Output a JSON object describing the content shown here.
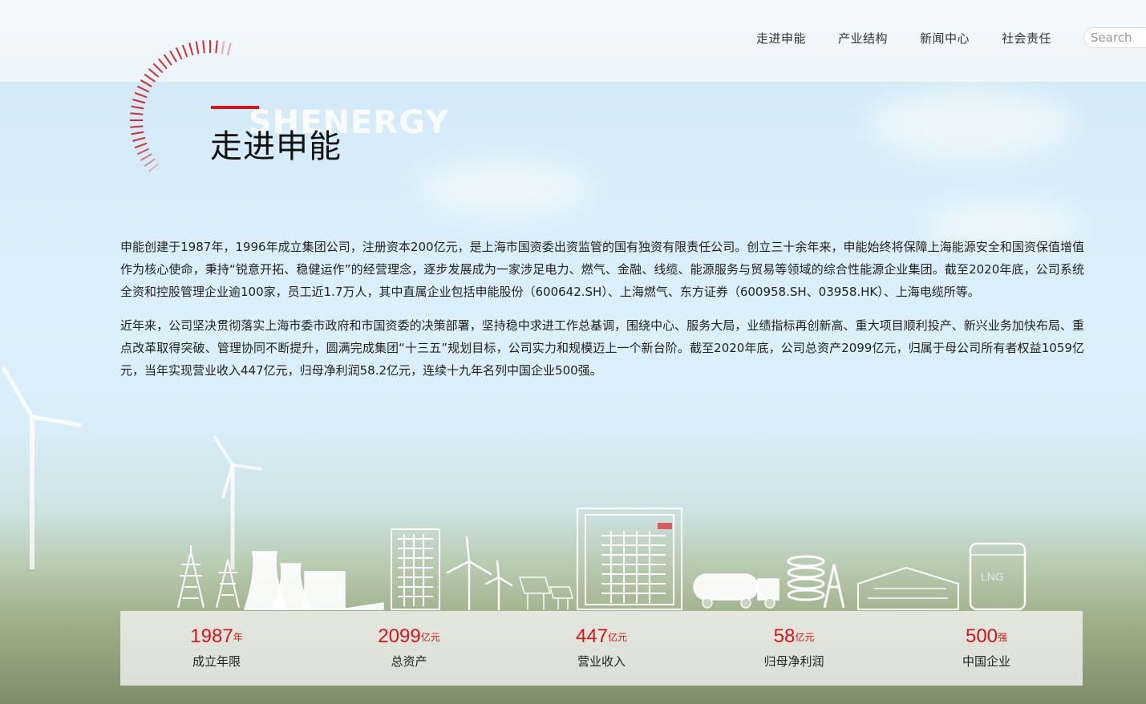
{
  "nav": {
    "items": [
      "走进申能",
      "产业结构",
      "新闻中心",
      "社会责任"
    ],
    "search_placeholder": "Search"
  },
  "hero": {
    "title_en": "SHENERGY",
    "title_cn": "走进申能"
  },
  "intro": {
    "paragraphs": [
      "申能创建于1987年，1996年成立集团公司，注册资本200亿元，是上海市国资委出资监管的国有独资有限责任公司。创立三十余年来，申能始终将保障上海能源安全和国资保值增值作为核心使命，秉持“锐意开拓、稳健运作”的经营理念，逐步发展成为一家涉足电力、燃气、金融、线缆、能源服务与贸易等领域的综合性能源企业集团。截至2020年底，公司系统全资和控股管理企业逾100家，员工近1.7万人，其中直属企业包括申能股份（600642.SH）、上海燃气、东方证券（600958.SH、03958.HK）、上海电缆所等。",
      "近年来，公司坚决贯彻落实上海市委市政府和市国资委的决策部署，坚持稳中求进工作总基调，围绕中心、服务大局，业绩指标再创新高、重大项目顺利投产、新兴业务加快布局、重点改革取得突破、管理协同不断提升，圆满完成集团“十三五”规划目标，公司实力和规模迈上一个新台阶。截至2020年底，公司总资产2099亿元，归属于母公司所有者权益1059亿元，当年实现营业收入447亿元，归母净利润58.2亿元，连续十九年名列中国企业500强。"
    ]
  },
  "skyline": {
    "lng_label": "LNG"
  },
  "stats": [
    {
      "value": "1987",
      "unit": "年",
      "label": "成立年限"
    },
    {
      "value": "2099",
      "unit": "亿元",
      "label": "总资产"
    },
    {
      "value": "447",
      "unit": "亿元",
      "label": "营业收入"
    },
    {
      "value": "58",
      "unit": "亿元",
      "label": "归母净利润"
    },
    {
      "value": "500",
      "unit": "强",
      "label": "中国企业"
    }
  ],
  "colors": {
    "accent": "#d7141b",
    "text": "#222222"
  }
}
